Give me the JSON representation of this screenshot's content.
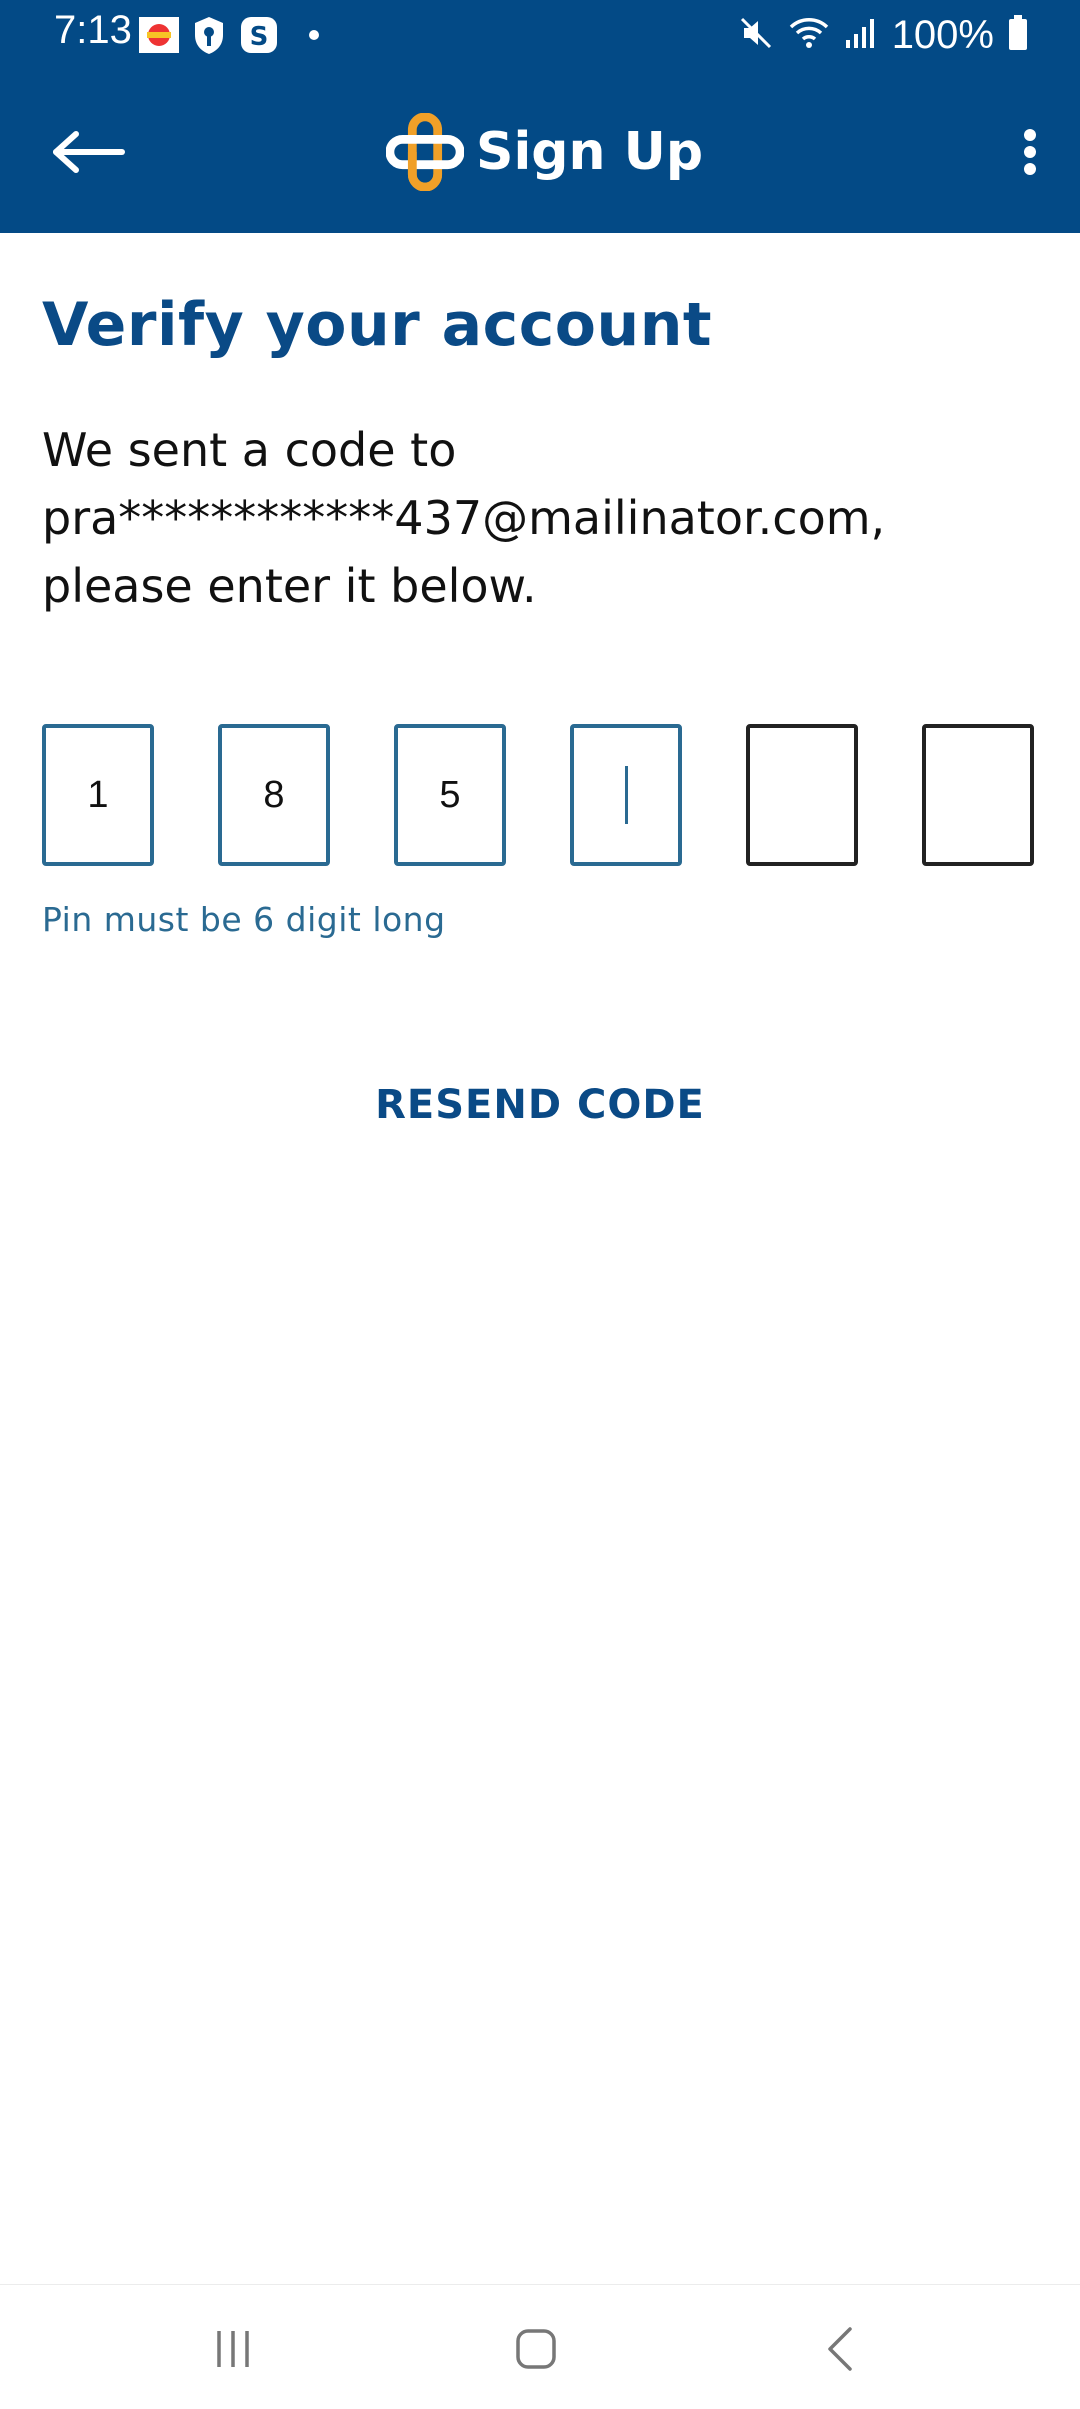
{
  "status_bar": {
    "time": "7:13",
    "battery": "100%",
    "icons": [
      "app-notification-icon",
      "shield-icon",
      "skype-icon",
      "dot-icon",
      "mute-icon",
      "wifi-icon",
      "signal-icon",
      "battery-icon"
    ]
  },
  "app_bar": {
    "title": "Sign Up",
    "icons": [
      "back-arrow-icon",
      "app-logo-icon",
      "more-vert-icon"
    ]
  },
  "content": {
    "title": "Verify your account",
    "description": "We sent a code to pra************437@mailinator.com, please enter it below.",
    "pin_digits": [
      "1",
      "8",
      "5",
      "",
      "",
      ""
    ],
    "pin_hint": "Pin must be 6 digit long",
    "resend_label": "RESEND CODE"
  },
  "nav_bar": {
    "icons": [
      "recents-icon",
      "home-icon",
      "back-icon"
    ]
  },
  "colors": {
    "brand_blue": "#034a86",
    "accent_orange": "#f0a028",
    "pin_border_active": "#2a6a92",
    "pin_border_empty": "#222222"
  }
}
